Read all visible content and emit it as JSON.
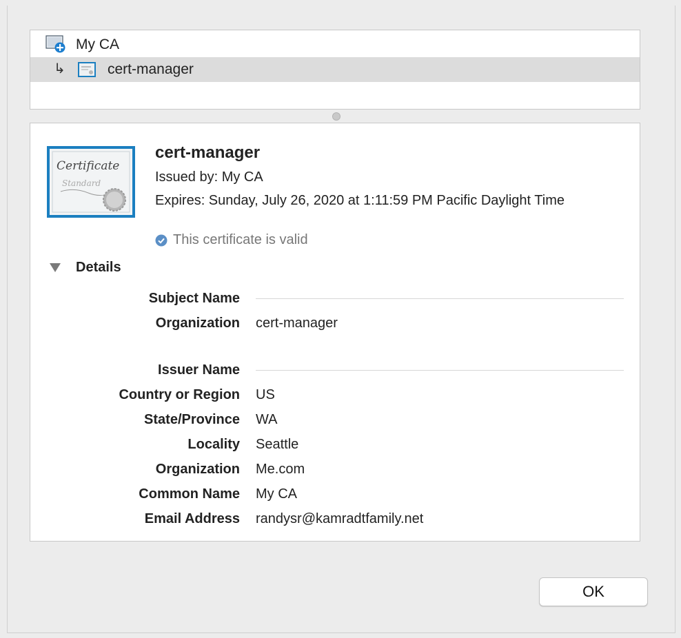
{
  "chain": {
    "items": [
      {
        "label": "My CA",
        "icon": "ca-root-certificate-icon"
      },
      {
        "label": "cert-manager",
        "icon": "certificate-icon",
        "prefix": "↳"
      }
    ]
  },
  "detail": {
    "title": "cert-manager",
    "issued_by": "Issued by: My CA",
    "expires": "Expires: Sunday, July 26, 2020 at 1:11:59 PM Pacific Daylight Time",
    "status": "This certificate is valid",
    "certificate_image_text": {
      "line1": "Certificate",
      "line2": "Standard"
    },
    "details_label": "Details",
    "subject_section": "Subject Name",
    "subject_fields": [
      {
        "label": "Organization",
        "value": "cert-manager"
      }
    ],
    "issuer_section": "Issuer Name",
    "issuer_fields": [
      {
        "label": "Country or Region",
        "value": "US"
      },
      {
        "label": "State/Province",
        "value": "WA"
      },
      {
        "label": "Locality",
        "value": "Seattle"
      },
      {
        "label": "Organization",
        "value": "Me.com"
      },
      {
        "label": "Common Name",
        "value": "My CA"
      },
      {
        "label": "Email Address",
        "value": "randysr@kamradtfamily.net"
      }
    ]
  },
  "buttons": {
    "ok": "OK"
  },
  "colors": {
    "valid_icon": "#5b8fc6",
    "selected_row": "#dcdcdc",
    "cert_border": "#1b7fc0"
  }
}
